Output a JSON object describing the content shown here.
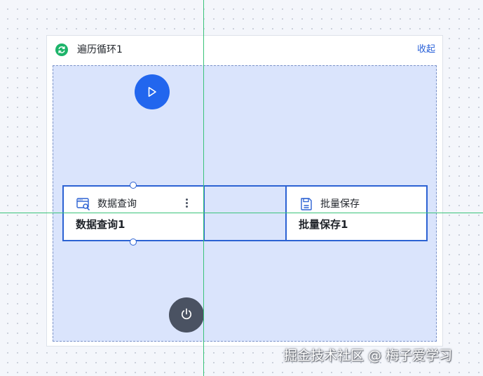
{
  "loop": {
    "title": "遍历循环1",
    "collapse_label": "收起",
    "icon": "loop-refresh-icon",
    "icon_color": "#1db46a"
  },
  "flow": {
    "start_icon": "play-icon",
    "end_icon": "power-icon",
    "accent_color": "#2266ee"
  },
  "nodes": [
    {
      "type_label": "数据查询",
      "name": "数据查询1",
      "icon": "data-query-icon",
      "menu_icon": "more-vertical-icon"
    },
    {
      "type_label": "批量保存",
      "name": "批量保存1",
      "icon": "save-icon"
    }
  ],
  "watermark": "掘金技术社区 @ 梅子爱学习"
}
